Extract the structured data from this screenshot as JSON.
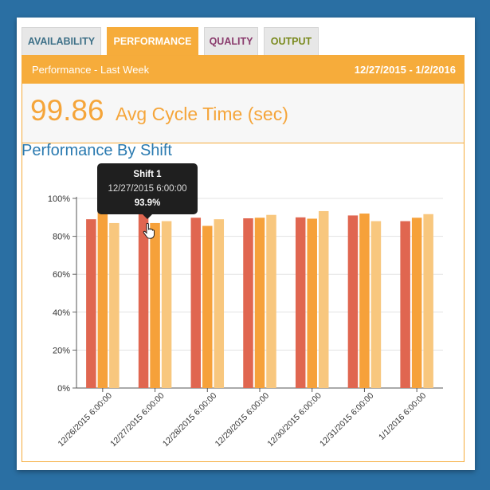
{
  "tabs": [
    {
      "label": "AVAILABILITY",
      "color": "#3f7188",
      "active": false
    },
    {
      "label": "PERFORMANCE",
      "color": "#ffffff",
      "active": true
    },
    {
      "label": "QUALITY",
      "color": "#8a3b6d",
      "active": false
    },
    {
      "label": "OUTPUT",
      "color": "#7a8a1e",
      "active": false
    }
  ],
  "panel": {
    "title": "Performance - Last Week",
    "date_range": "12/27/2015 - 1/2/2016"
  },
  "kpi": {
    "value": "99.86",
    "label": "Avg Cycle Time (sec)"
  },
  "chart_title": "Performance By Shift",
  "tooltip": {
    "series": "Shift 1",
    "date": "12/27/2015 6:00:00",
    "value": "93.9%"
  },
  "colors": {
    "accent": "#f6ac3b",
    "shift1": "#e06650",
    "shift2": "#f6a13a",
    "shift3": "#f8c77e",
    "tab_bg": "#e7e7e7"
  },
  "chart_data": {
    "type": "bar",
    "categories": [
      "12/26/2015 6:00:00",
      "12/27/2015 6:00:00",
      "12/28/2015 6:00:00",
      "12/29/2015 6:00:00",
      "12/30/2015 6:00:00",
      "12/31/2015 6:00:00",
      "1/1/2016 6:00:00"
    ],
    "series": [
      {
        "name": "Shift 1",
        "values": [
          89.0,
          93.9,
          89.8,
          89.5,
          90.0,
          91.0,
          88.0
        ]
      },
      {
        "values": [
          93.0,
          87.0,
          85.5,
          89.8,
          89.3,
          92.0,
          89.8
        ]
      },
      {
        "values": [
          87.0,
          88.0,
          89.0,
          91.3,
          93.3,
          88.0,
          91.7
        ]
      }
    ],
    "ylim": [
      0,
      100
    ],
    "yticks": [
      "0%",
      "20%",
      "40%",
      "60%",
      "80%",
      "100%"
    ],
    "ytick_values": [
      0,
      20,
      40,
      60,
      80,
      100
    ],
    "grid": true
  }
}
